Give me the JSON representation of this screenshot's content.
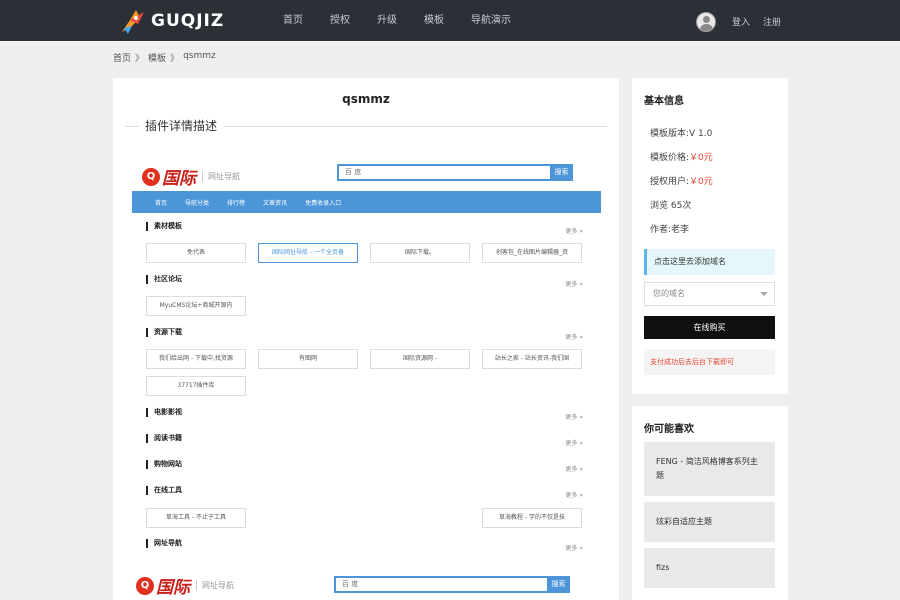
{
  "header": {
    "logo_text": "GUQJIZ",
    "nav": [
      "首页",
      "授权",
      "升级",
      "模板",
      "导航演示"
    ],
    "login": "登入",
    "register": "注册"
  },
  "breadcrumb": [
    "首页",
    "模板",
    "qsmmz"
  ],
  "breadcrumb_sep": "》",
  "main": {
    "title": "qsmmz",
    "section_label": "插件详情描述"
  },
  "preview": {
    "logo_mark": "Q",
    "logo_text": "国际",
    "logo_sub": "网址导航",
    "search_placeholder": "百 度",
    "search_btn": "搜索",
    "nav": [
      "首页",
      "导航分类",
      "排行榜",
      "文章资讯",
      "免费收录入口"
    ],
    "more": "更多 »",
    "sections": [
      {
        "title": "素材模板",
        "items": [
          "免代表",
          "国际网址导航 - 一个全页备",
          "国际下载。",
          "创客包_在线图片编辑器_资"
        ]
      },
      {
        "title": "社区论坛",
        "items": [
          "MyuCMS论坛+商城开源内"
        ]
      },
      {
        "title": "资源下载",
        "items": [
          "我们给出网 - 下载中,找资源",
          "有图网",
          "国际资源网 -",
          "站长之家 - 站长资讯-我们国",
          "37717插件库"
        ]
      },
      {
        "title": "电影影视",
        "items": []
      },
      {
        "title": "阅读书籍",
        "items": []
      },
      {
        "title": "购物网站",
        "items": []
      },
      {
        "title": "在线工具",
        "items": [
          "草海工具 - 不止于工具",
          "草海教程 - 学的不仅是技"
        ]
      },
      {
        "title": "网址导航",
        "items": []
      }
    ]
  },
  "sidebar": {
    "info_title": "基本信息",
    "version": "模板版本:V 1.0",
    "price_label": "模板价格:",
    "price_value": "￥0元",
    "auth_label": "授权用户:",
    "auth_value": "￥0元",
    "views": "浏览 65次",
    "author": "作者:老李",
    "domain_hint": "点击这里去添加域名",
    "domain_placeholder": "您的域名",
    "buy_btn": "在线购买",
    "pay_note": "支付成功后去后台下载即可",
    "like_title": "你可能喜欢",
    "likes": [
      "FENG - 简洁风格博客系列主题",
      "炫彩自适应主题",
      "fizs"
    ]
  },
  "colors": {
    "topbar": "#2b2f36",
    "accent_blue": "#4b95d8",
    "price_red": "#e8442c",
    "buy_btn": "#0f1012"
  }
}
